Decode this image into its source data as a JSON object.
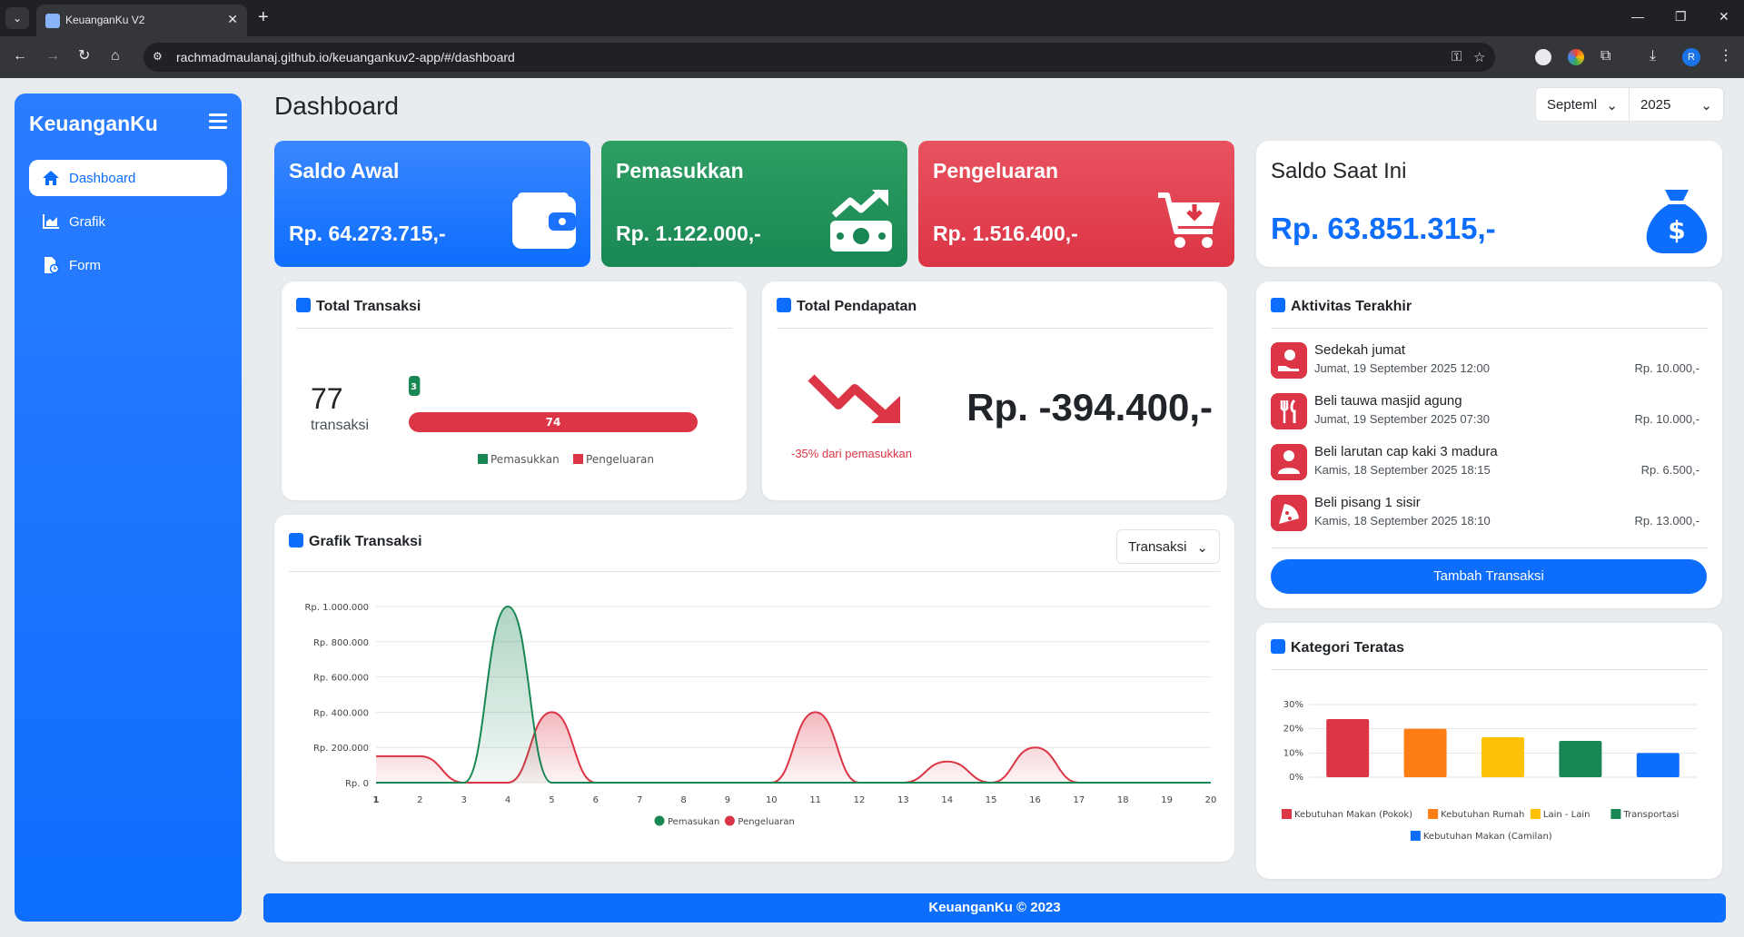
{
  "browser": {
    "tab_title": "KeuanganKu V2",
    "url": "rachmadmaulanaj.github.io/keuangankuv2-app/#/dashboard",
    "profile_initial": "R"
  },
  "sidebar": {
    "brand": "KeuanganKu",
    "items": [
      {
        "label": "Dashboard",
        "icon": "home-icon",
        "active": true
      },
      {
        "label": "Grafik",
        "icon": "chart-icon",
        "active": false
      },
      {
        "label": "Form",
        "icon": "form-icon",
        "active": false
      }
    ]
  },
  "header": {
    "title": "Dashboard",
    "month_value": "Septeml",
    "year_value": "2025"
  },
  "stats": {
    "saldo_awal": {
      "title": "Saldo Awal",
      "value": "Rp. 64.273.715,-",
      "color": "#0d6efd"
    },
    "pemasukkan": {
      "title": "Pemasukkan",
      "value": "Rp. 1.122.000,-",
      "color": "#198754"
    },
    "pengeluaran": {
      "title": "Pengeluaran",
      "value": "Rp. 1.516.400,-",
      "color": "#dc3545"
    },
    "saldo_saat_ini": {
      "title": "Saldo Saat Ini",
      "value": "Rp. 63.851.315,-"
    }
  },
  "total_transaksi": {
    "title": "Total Transaksi",
    "count": "77",
    "unit": "transaksi",
    "income_count": "3",
    "expense_count": "74",
    "income_fraction": 0.039,
    "legend": [
      "Pemasukkan",
      "Pengeluaran"
    ]
  },
  "total_pendapatan": {
    "title": "Total Pendapatan",
    "value": "Rp. -394.400,-",
    "note": "-35% dari pemasukkan",
    "trend_icon": "trend-down-icon"
  },
  "aktivitas": {
    "title": "Aktivitas Terakhir",
    "items": [
      {
        "name": "Sedekah jumat",
        "date": "Jumat, 19 September 2025 12:00",
        "amount": "Rp. 10.000,-",
        "icon": "charity-icon"
      },
      {
        "name": "Beli tauwa masjid agung",
        "date": "Jumat, 19 September 2025 07:30",
        "amount": "Rp. 10.000,-",
        "icon": "utensils-icon"
      },
      {
        "name": "Beli larutan cap kaki 3 madura",
        "date": "Kamis, 18 September 2025 18:15",
        "amount": "Rp. 6.500,-",
        "icon": "person-icon"
      },
      {
        "name": "Beli pisang 1 sisir",
        "date": "Kamis, 18 September 2025 18:10",
        "amount": "Rp. 13.000,-",
        "icon": "pizza-icon"
      }
    ],
    "button": "Tambah Transaksi"
  },
  "grafik": {
    "title": "Grafik Transaksi",
    "select_value": "Transaksi"
  },
  "kategori": {
    "title": "Kategori Teratas"
  },
  "footer": "KeuanganKu © 2023",
  "chart_data": [
    {
      "type": "line",
      "title": "Grafik Transaksi",
      "x": [
        1,
        2,
        3,
        4,
        5,
        6,
        7,
        8,
        9,
        10,
        11,
        12,
        13,
        14,
        15,
        16,
        17,
        18,
        19,
        20
      ],
      "y_ticks": [
        "Rp. 0",
        "Rp. 200.000",
        "Rp. 400.000",
        "Rp. 600.000",
        "Rp. 800.000",
        "Rp. 1.000.000"
      ],
      "ylim": [
        0,
        1000000
      ],
      "series": [
        {
          "name": "Pemasukan",
          "color": "#198754",
          "values": [
            0,
            0,
            0,
            1000000,
            0,
            0,
            0,
            0,
            0,
            0,
            0,
            0,
            0,
            0,
            0,
            0,
            0,
            0,
            0,
            0
          ]
        },
        {
          "name": "Pengeluaran",
          "color": "#dc3545",
          "values": [
            150000,
            150000,
            0,
            0,
            400000,
            0,
            0,
            0,
            0,
            0,
            400000,
            0,
            0,
            120000,
            0,
            200000,
            0,
            0,
            0,
            0
          ]
        }
      ],
      "legend": "bottom",
      "grid": true
    },
    {
      "type": "bar",
      "title": "Kategori Teratas",
      "categories": [
        "Kebutuhan Makan (Pokok)",
        "Kebutuhan Rumah",
        "Lain - Lain",
        "Transportasi",
        "Kebutuhan Makan (Camilan)"
      ],
      "values": [
        24,
        20,
        16.5,
        15,
        10
      ],
      "colors": [
        "#dc3545",
        "#fd7e14",
        "#ffc107",
        "#198754",
        "#0d6efd"
      ],
      "y_ticks": [
        "0%",
        "10%",
        "20%",
        "30%"
      ],
      "ylim": [
        0,
        30
      ],
      "legend": "bottom",
      "grid": true
    }
  ]
}
